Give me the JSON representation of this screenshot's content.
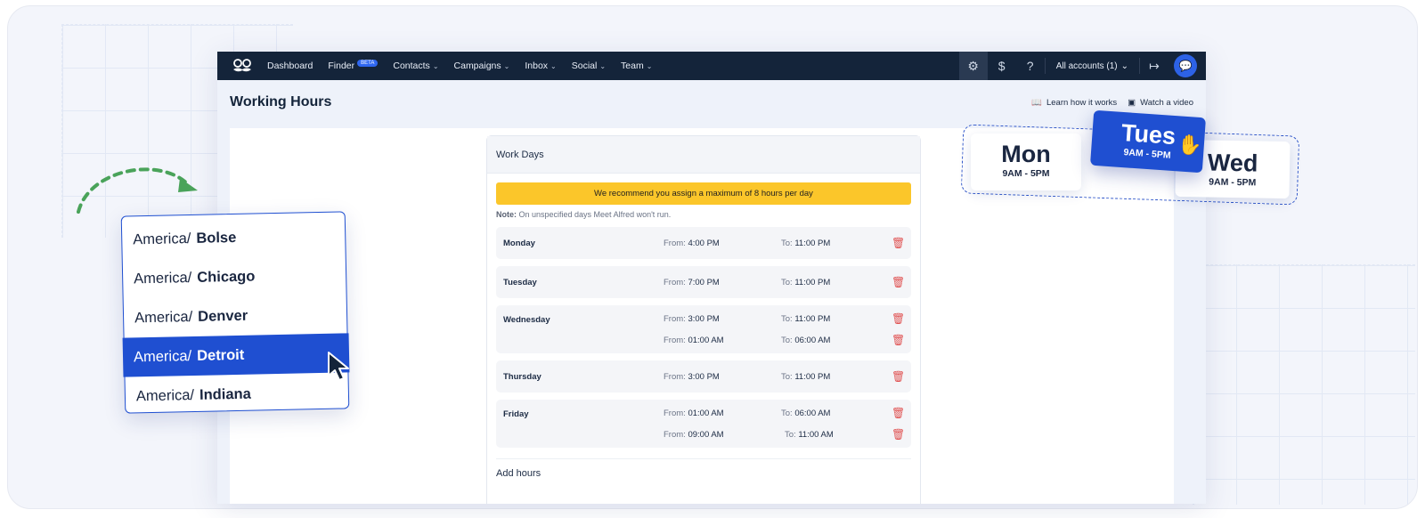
{
  "nav": {
    "items": [
      {
        "label": "Dashboard",
        "dropdown": false
      },
      {
        "label": "Finder",
        "dropdown": false,
        "badge": "BETA"
      },
      {
        "label": "Contacts",
        "dropdown": true
      },
      {
        "label": "Campaigns",
        "dropdown": true
      },
      {
        "label": "Inbox",
        "dropdown": true
      },
      {
        "label": "Social",
        "dropdown": true
      },
      {
        "label": "Team",
        "dropdown": true
      }
    ],
    "accounts_label": "All accounts (1)"
  },
  "page": {
    "title": "Working Hours",
    "learn_link": "Learn how it works",
    "video_link": "Watch a video"
  },
  "work_days": {
    "title": "Work Days",
    "warning": "We recommend you assign a maximum of 8 hours per day",
    "note_label": "Note:",
    "note_text": " On unspecified days Meet Alfred won't run.",
    "from_label": "From:",
    "to_label": "To:",
    "days": [
      {
        "name": "Monday",
        "slots": [
          {
            "from": "4:00 PM",
            "to": "11:00 PM"
          }
        ]
      },
      {
        "name": "Tuesday",
        "slots": [
          {
            "from": "7:00 PM",
            "to": "11:00 PM"
          }
        ]
      },
      {
        "name": "Wednesday",
        "slots": [
          {
            "from": "3:00 PM",
            "to": "11:00 PM"
          },
          {
            "from": "01:00 AM",
            "to": "06:00 AM"
          }
        ]
      },
      {
        "name": "Thursday",
        "slots": [
          {
            "from": "3:00 PM",
            "to": "11:00 PM"
          }
        ]
      },
      {
        "name": "Friday",
        "slots": [
          {
            "from": "01:00 AM",
            "to": "06:00 AM"
          },
          {
            "from": "09:00 AM",
            "to": "11:00 AM"
          }
        ]
      }
    ],
    "add_hours": "Add hours"
  },
  "timezones": {
    "prefix": "America/",
    "items": [
      {
        "city": "Bolse",
        "selected": false
      },
      {
        "city": "Chicago",
        "selected": false
      },
      {
        "city": "Denver",
        "selected": false
      },
      {
        "city": "Detroit",
        "selected": true
      },
      {
        "city": "Indiana",
        "selected": false
      }
    ]
  },
  "day_cards": {
    "mon": {
      "day": "Mon",
      "hours": "9AM - 5PM"
    },
    "tues": {
      "day": "Tues",
      "hours": "9AM - 5PM"
    },
    "wed": {
      "day": "Wed",
      "hours": "9AM - 5PM"
    }
  },
  "colors": {
    "nav_bg": "#14243a",
    "accent": "#1f4fd1",
    "warning": "#fbc62a",
    "delete": "#e05252",
    "arrow": "#4aa35a"
  }
}
